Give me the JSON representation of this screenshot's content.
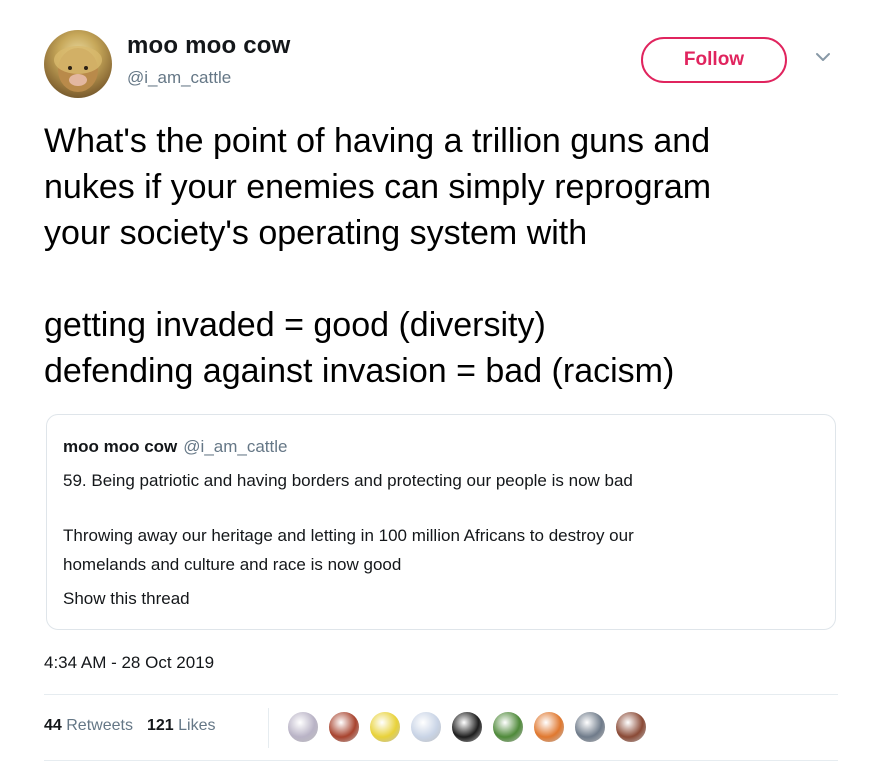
{
  "author": {
    "display_name": "moo moo cow",
    "handle": "@i_am_cattle"
  },
  "follow_button": {
    "label": "Follow",
    "color": "#e0245e"
  },
  "tweet": {
    "lines": [
      "What's the point of having a trillion guns and",
      "nukes if your enemies can simply reprogram",
      "your society's operating system with",
      "getting invaded = good (diversity)",
      "defending against invasion = bad (racism)"
    ]
  },
  "quote": {
    "display_name": "moo moo cow",
    "handle": "@i_am_cattle",
    "line1": "59. Being patriotic and having borders and protecting our people is now bad",
    "line2": "Throwing away our heritage and letting in 100 million Africans to destroy our",
    "line3": "homelands and culture and race is now good",
    "show_thread": "Show this thread"
  },
  "timestamp": "4:34 AM - 28 Oct 2019",
  "stats": {
    "retweets_count": "44",
    "retweets_label": "Retweets",
    "likes_count": "121",
    "likes_label": "Likes"
  },
  "likers": [
    {
      "icon": "liker-avatar",
      "color": "#b9b3c6"
    },
    {
      "icon": "liker-avatar",
      "color": "#a8442f"
    },
    {
      "icon": "liker-avatar",
      "color": "#e8d23a"
    },
    {
      "icon": "liker-avatar",
      "color": "#c9d4e6"
    },
    {
      "icon": "liker-avatar",
      "color": "#1e1e1e"
    },
    {
      "icon": "liker-avatar",
      "color": "#4f8a3a"
    },
    {
      "icon": "liker-avatar",
      "color": "#e0782f"
    },
    {
      "icon": "liker-avatar",
      "color": "#6f7b8a"
    },
    {
      "icon": "liker-avatar",
      "color": "#8a4a36"
    }
  ]
}
